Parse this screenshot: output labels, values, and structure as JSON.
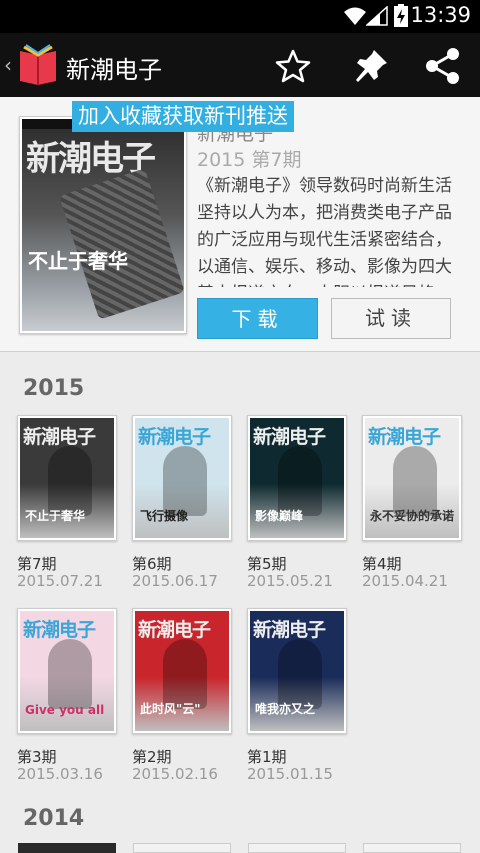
{
  "status": {
    "time": "13:39"
  },
  "actionbar": {
    "title": "新潮电子"
  },
  "tooltip": "加入收藏获取新刊推送",
  "detail": {
    "title": "新潮电子",
    "issue": "2015 第7期",
    "description": "《新潮电子》领导数码时尚新生活 坚持以人为本，把消费类电子产品的广泛应用与现代生活紧密结合，以通信、娱乐、移动、影像为四大基本报道方向，大胆以报道风格、最新趋势",
    "download_label": "下载",
    "trial_label": "试读",
    "cover": {
      "masthead": "新潮电子",
      "headline": "不止于奢华"
    }
  },
  "sections": [
    {
      "year": "2015",
      "issues": [
        {
          "label": "第7期",
          "date": "2015.07.21",
          "masthead": "新潮电子",
          "cover_text": "不止于奢华",
          "bg": "#3a3a3a",
          "text_color": "#fff"
        },
        {
          "label": "第6期",
          "date": "2015.06.17",
          "masthead": "新潮电子",
          "cover_text": "飞行摄像",
          "bg": "#cfe4ec",
          "text_color": "#222"
        },
        {
          "label": "第5期",
          "date": "2015.05.21",
          "masthead": "新潮电子",
          "cover_text": "影像巅峰",
          "bg": "#0e2a30",
          "text_color": "#fff"
        },
        {
          "label": "第4期",
          "date": "2015.04.21",
          "masthead": "新潮电子",
          "cover_text": "永不妥协的承诺",
          "bg": "#ececec",
          "text_color": "#333"
        },
        {
          "label": "第3期",
          "date": "2015.03.16",
          "masthead": "新潮电子",
          "cover_text": "Give you all",
          "bg": "#f3d7e3",
          "text_color": "#d0306a"
        },
        {
          "label": "第2期",
          "date": "2015.02.16",
          "masthead": "新潮电子",
          "cover_text": "此时风\"云\"",
          "bg": "#c8262c",
          "text_color": "#fff"
        },
        {
          "label": "第1期",
          "date": "2015.01.15",
          "masthead": "新潮电子",
          "cover_text": "唯我亦又之",
          "bg": "#1a2c5a",
          "text_color": "#fff"
        }
      ]
    },
    {
      "year": "2014"
    }
  ],
  "colors": {
    "accent": "#33aee1",
    "actionbar": "#111111"
  }
}
